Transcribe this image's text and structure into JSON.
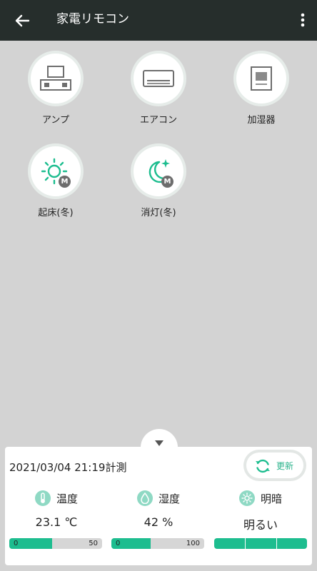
{
  "appbar": {
    "title": "家電リモコン"
  },
  "devices": [
    {
      "label": "アンプ",
      "icon": "amplifier-icon"
    },
    {
      "label": "エアコン",
      "icon": "air-conditioner-icon"
    },
    {
      "label": "加湿器",
      "icon": "humidifier-icon"
    },
    {
      "label": "起床(冬)",
      "icon": "sun-icon",
      "badge": "M"
    },
    {
      "label": "消灯(冬)",
      "icon": "moon-icon",
      "badge": "M"
    }
  ],
  "panel": {
    "timestamp": "2021/03/04 21:19計測",
    "refresh_label": "更新",
    "temperature": {
      "label": "温度",
      "value": "23.1 ℃",
      "min": "0",
      "max": "50",
      "fraction": 0.462
    },
    "humidity": {
      "label": "湿度",
      "value": "42 %",
      "min": "0",
      "max": "100",
      "fraction": 0.42
    },
    "brightness": {
      "label": "明暗",
      "value": "明るい",
      "level": 3,
      "levels": 3
    }
  },
  "colors": {
    "accent": "#1dbd8f",
    "appbar": "#262e2c",
    "background": "#d3d3d3"
  }
}
